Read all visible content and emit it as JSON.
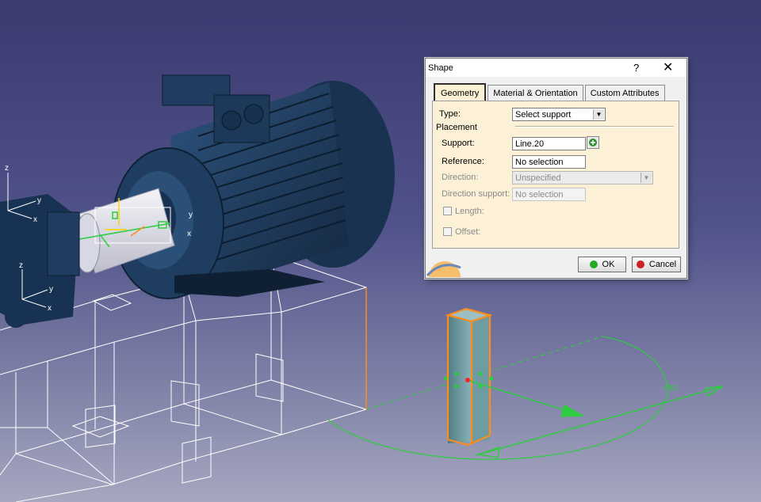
{
  "dialog": {
    "title": "Shape",
    "help_label": "?",
    "close_label": "✕",
    "tabs": [
      "Geometry",
      "Material & Orientation",
      "Custom Attributes"
    ],
    "type_label": "Type:",
    "type_value": "Select support",
    "placement_label": "Placement",
    "support_label": "Support:",
    "support_value": "Line.20",
    "reference_label": "Reference:",
    "reference_value": "No selection",
    "direction_label": "Direction:",
    "direction_value": "Unspecified",
    "direction_support_label": "Direction support:",
    "direction_support_value": "No selection",
    "length_label": "Length:",
    "offset_label": "Offset:",
    "ok_label": "OK",
    "cancel_label": "Cancel"
  },
  "viewport": {
    "angle_label": "+90",
    "axis_labels": [
      "z",
      "y",
      "x"
    ]
  },
  "colors": {
    "background_top": "#3a3b6f",
    "background_bottom": "#a6a8c0",
    "motor_blue": "#1e3a5c",
    "selection_green": "#33dd33",
    "beam_orange": "#ff8c1a",
    "wireframe": "#ffffff",
    "ok_green": "#22aa22",
    "cancel_red": "#cc2222",
    "tab_panel": "#fcf1d6"
  }
}
